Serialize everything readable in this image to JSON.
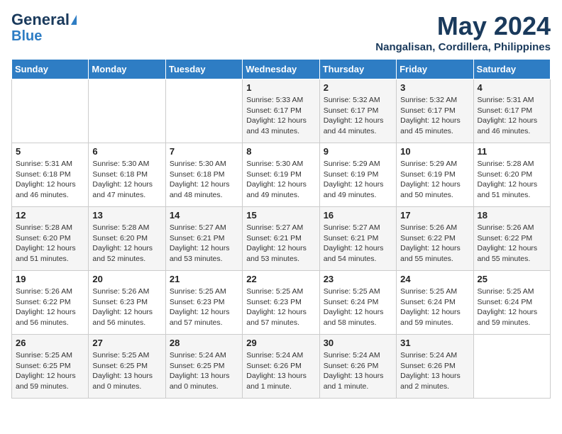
{
  "logo": {
    "line1": "General",
    "line2": "Blue"
  },
  "title": "May 2024",
  "location": "Nangalisan, Cordillera, Philippines",
  "weekdays": [
    "Sunday",
    "Monday",
    "Tuesday",
    "Wednesday",
    "Thursday",
    "Friday",
    "Saturday"
  ],
  "weeks": [
    [
      {
        "day": "",
        "info": ""
      },
      {
        "day": "",
        "info": ""
      },
      {
        "day": "",
        "info": ""
      },
      {
        "day": "1",
        "info": "Sunrise: 5:33 AM\nSunset: 6:17 PM\nDaylight: 12 hours\nand 43 minutes."
      },
      {
        "day": "2",
        "info": "Sunrise: 5:32 AM\nSunset: 6:17 PM\nDaylight: 12 hours\nand 44 minutes."
      },
      {
        "day": "3",
        "info": "Sunrise: 5:32 AM\nSunset: 6:17 PM\nDaylight: 12 hours\nand 45 minutes."
      },
      {
        "day": "4",
        "info": "Sunrise: 5:31 AM\nSunset: 6:17 PM\nDaylight: 12 hours\nand 46 minutes."
      }
    ],
    [
      {
        "day": "5",
        "info": "Sunrise: 5:31 AM\nSunset: 6:18 PM\nDaylight: 12 hours\nand 46 minutes."
      },
      {
        "day": "6",
        "info": "Sunrise: 5:30 AM\nSunset: 6:18 PM\nDaylight: 12 hours\nand 47 minutes."
      },
      {
        "day": "7",
        "info": "Sunrise: 5:30 AM\nSunset: 6:18 PM\nDaylight: 12 hours\nand 48 minutes."
      },
      {
        "day": "8",
        "info": "Sunrise: 5:30 AM\nSunset: 6:19 PM\nDaylight: 12 hours\nand 49 minutes."
      },
      {
        "day": "9",
        "info": "Sunrise: 5:29 AM\nSunset: 6:19 PM\nDaylight: 12 hours\nand 49 minutes."
      },
      {
        "day": "10",
        "info": "Sunrise: 5:29 AM\nSunset: 6:19 PM\nDaylight: 12 hours\nand 50 minutes."
      },
      {
        "day": "11",
        "info": "Sunrise: 5:28 AM\nSunset: 6:20 PM\nDaylight: 12 hours\nand 51 minutes."
      }
    ],
    [
      {
        "day": "12",
        "info": "Sunrise: 5:28 AM\nSunset: 6:20 PM\nDaylight: 12 hours\nand 51 minutes."
      },
      {
        "day": "13",
        "info": "Sunrise: 5:28 AM\nSunset: 6:20 PM\nDaylight: 12 hours\nand 52 minutes."
      },
      {
        "day": "14",
        "info": "Sunrise: 5:27 AM\nSunset: 6:21 PM\nDaylight: 12 hours\nand 53 minutes."
      },
      {
        "day": "15",
        "info": "Sunrise: 5:27 AM\nSunset: 6:21 PM\nDaylight: 12 hours\nand 53 minutes."
      },
      {
        "day": "16",
        "info": "Sunrise: 5:27 AM\nSunset: 6:21 PM\nDaylight: 12 hours\nand 54 minutes."
      },
      {
        "day": "17",
        "info": "Sunrise: 5:26 AM\nSunset: 6:22 PM\nDaylight: 12 hours\nand 55 minutes."
      },
      {
        "day": "18",
        "info": "Sunrise: 5:26 AM\nSunset: 6:22 PM\nDaylight: 12 hours\nand 55 minutes."
      }
    ],
    [
      {
        "day": "19",
        "info": "Sunrise: 5:26 AM\nSunset: 6:22 PM\nDaylight: 12 hours\nand 56 minutes."
      },
      {
        "day": "20",
        "info": "Sunrise: 5:26 AM\nSunset: 6:23 PM\nDaylight: 12 hours\nand 56 minutes."
      },
      {
        "day": "21",
        "info": "Sunrise: 5:25 AM\nSunset: 6:23 PM\nDaylight: 12 hours\nand 57 minutes."
      },
      {
        "day": "22",
        "info": "Sunrise: 5:25 AM\nSunset: 6:23 PM\nDaylight: 12 hours\nand 57 minutes."
      },
      {
        "day": "23",
        "info": "Sunrise: 5:25 AM\nSunset: 6:24 PM\nDaylight: 12 hours\nand 58 minutes."
      },
      {
        "day": "24",
        "info": "Sunrise: 5:25 AM\nSunset: 6:24 PM\nDaylight: 12 hours\nand 59 minutes."
      },
      {
        "day": "25",
        "info": "Sunrise: 5:25 AM\nSunset: 6:24 PM\nDaylight: 12 hours\nand 59 minutes."
      }
    ],
    [
      {
        "day": "26",
        "info": "Sunrise: 5:25 AM\nSunset: 6:25 PM\nDaylight: 12 hours\nand 59 minutes."
      },
      {
        "day": "27",
        "info": "Sunrise: 5:25 AM\nSunset: 6:25 PM\nDaylight: 13 hours\nand 0 minutes."
      },
      {
        "day": "28",
        "info": "Sunrise: 5:24 AM\nSunset: 6:25 PM\nDaylight: 13 hours\nand 0 minutes."
      },
      {
        "day": "29",
        "info": "Sunrise: 5:24 AM\nSunset: 6:26 PM\nDaylight: 13 hours\nand 1 minute."
      },
      {
        "day": "30",
        "info": "Sunrise: 5:24 AM\nSunset: 6:26 PM\nDaylight: 13 hours\nand 1 minute."
      },
      {
        "day": "31",
        "info": "Sunrise: 5:24 AM\nSunset: 6:26 PM\nDaylight: 13 hours\nand 2 minutes."
      },
      {
        "day": "",
        "info": ""
      }
    ]
  ]
}
